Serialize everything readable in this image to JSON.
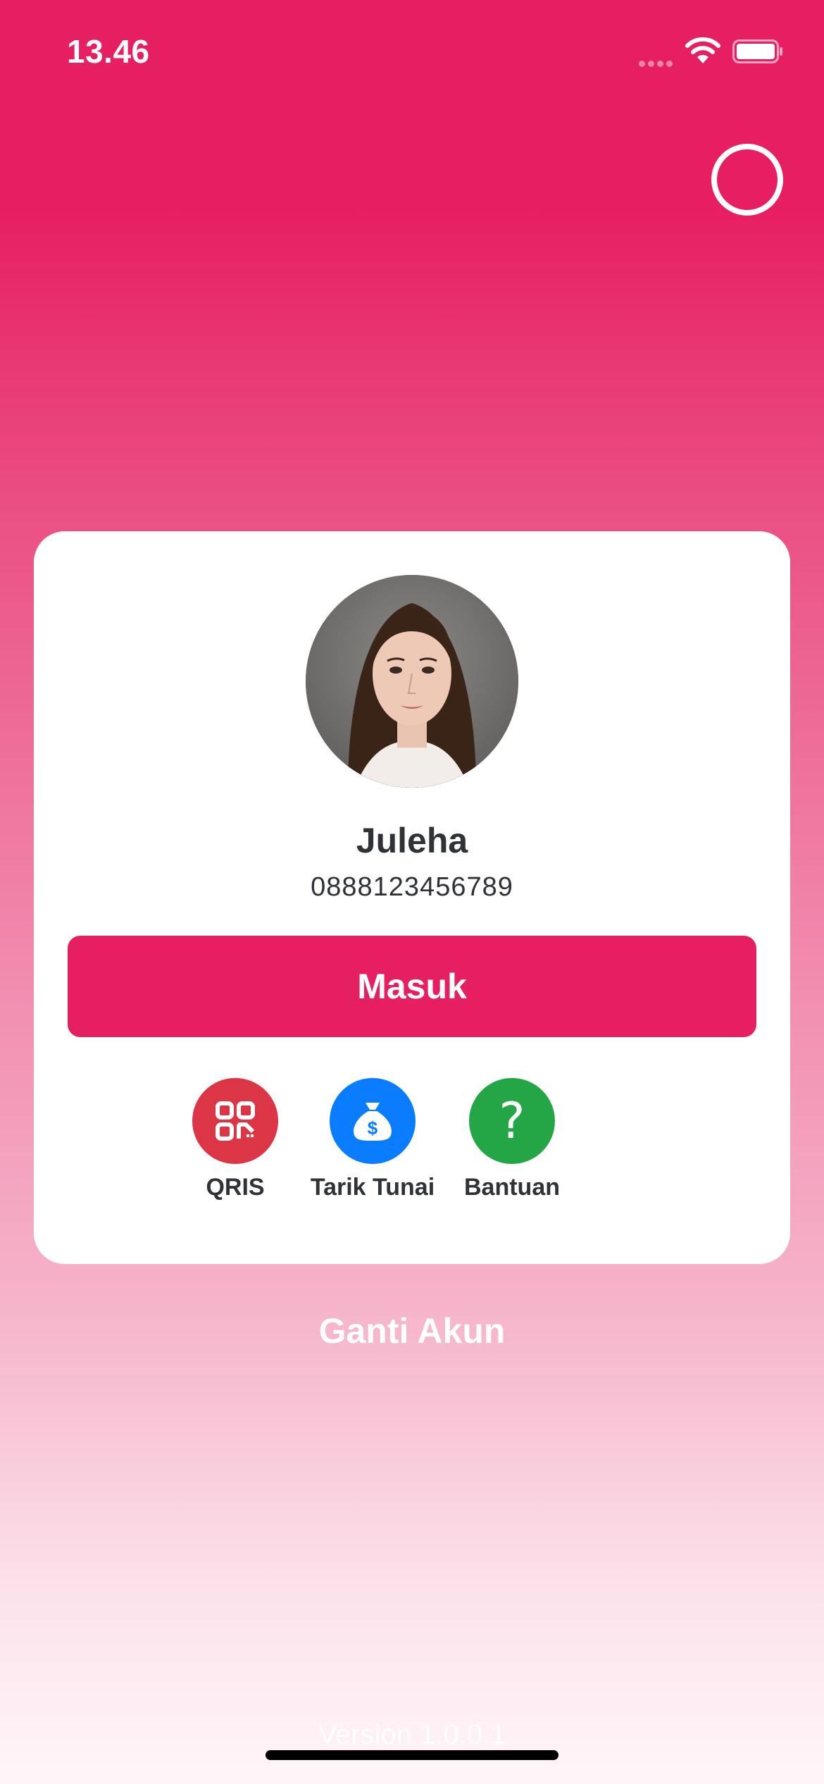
{
  "status_bar": {
    "time": "13.46"
  },
  "profile": {
    "name": "Juleha",
    "phone": "0888123456789"
  },
  "login_button": {
    "label": "Masuk"
  },
  "quick_actions": [
    {
      "label": "QRIS",
      "icon": "qr-code-icon",
      "color": "#dc3545"
    },
    {
      "label": "Tarik Tunai",
      "icon": "money-bag-icon",
      "color": "#0a7cff"
    },
    {
      "label": "Bantuan",
      "icon": "question-mark-icon",
      "color": "#24a646"
    }
  ],
  "switch_account": {
    "label": "Ganti Akun"
  },
  "version": {
    "label": "Version 1.0.0.1"
  },
  "colors": {
    "primary": "#e61f62",
    "text_dark": "#2f3237"
  }
}
